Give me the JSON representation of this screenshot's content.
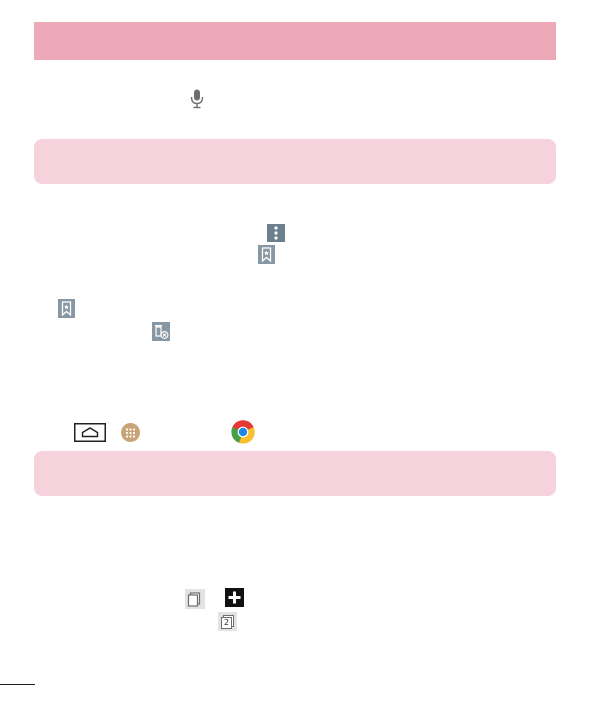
{
  "colors": {
    "header_bar": "#eea9b8",
    "note_box": "#f6d3dc",
    "icon_gray": "#7a8a96"
  },
  "icons": [
    "microphone-icon",
    "menu-overflow-icon",
    "bookmark-icon",
    "bookmark-icon",
    "delete-bookmark-icon",
    "home-key-icon",
    "apps-icon",
    "chrome-icon",
    "tabs-icon",
    "new-tab-plus-icon",
    "tabs-count-icon"
  ],
  "tab_count": "2"
}
